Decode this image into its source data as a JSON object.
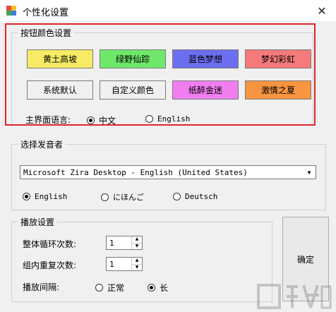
{
  "window": {
    "title": "个性化设置",
    "close_glyph": "✕"
  },
  "color_group": {
    "legend": "按钮颜色设置",
    "buttons": [
      {
        "label": "黄土高坡",
        "color": "#f7eb66"
      },
      {
        "label": "绿野仙踪",
        "color": "#6fe86a"
      },
      {
        "label": "蓝色梦想",
        "color": "#6c6ef0"
      },
      {
        "label": "梦幻彩虹",
        "color": "#f67a7a"
      },
      {
        "label": "系统默认",
        "color": "#f0f0f0"
      },
      {
        "label": "自定义颜色",
        "color": "#f0f0f0"
      },
      {
        "label": "纸醉金迷",
        "color": "#f07ef0"
      },
      {
        "label": "激情之夏",
        "color": "#f89540"
      }
    ],
    "language_label": "主界面语言:",
    "languages": [
      {
        "label": "中文",
        "selected": true
      },
      {
        "label": "English",
        "selected": false
      }
    ]
  },
  "voice_group": {
    "legend": "选择发音者",
    "selected_voice": "Microsoft Zira Desktop - English (United States)",
    "languages": [
      {
        "label": "English",
        "selected": true
      },
      {
        "label": "にほんご",
        "selected": false
      },
      {
        "label": "Deutsch",
        "selected": false
      }
    ]
  },
  "play_group": {
    "legend": "播放设置",
    "loop_label": "整体循环次数:",
    "loop_value": "1",
    "repeat_label": "组内重复次数:",
    "repeat_value": "1",
    "interval_label": "播放间隔:",
    "intervals": [
      {
        "label": "正常",
        "selected": false
      },
      {
        "label": "长",
        "selected": true
      }
    ]
  },
  "ok_label": "确定",
  "colors": {
    "highlight": "#e0262b"
  }
}
